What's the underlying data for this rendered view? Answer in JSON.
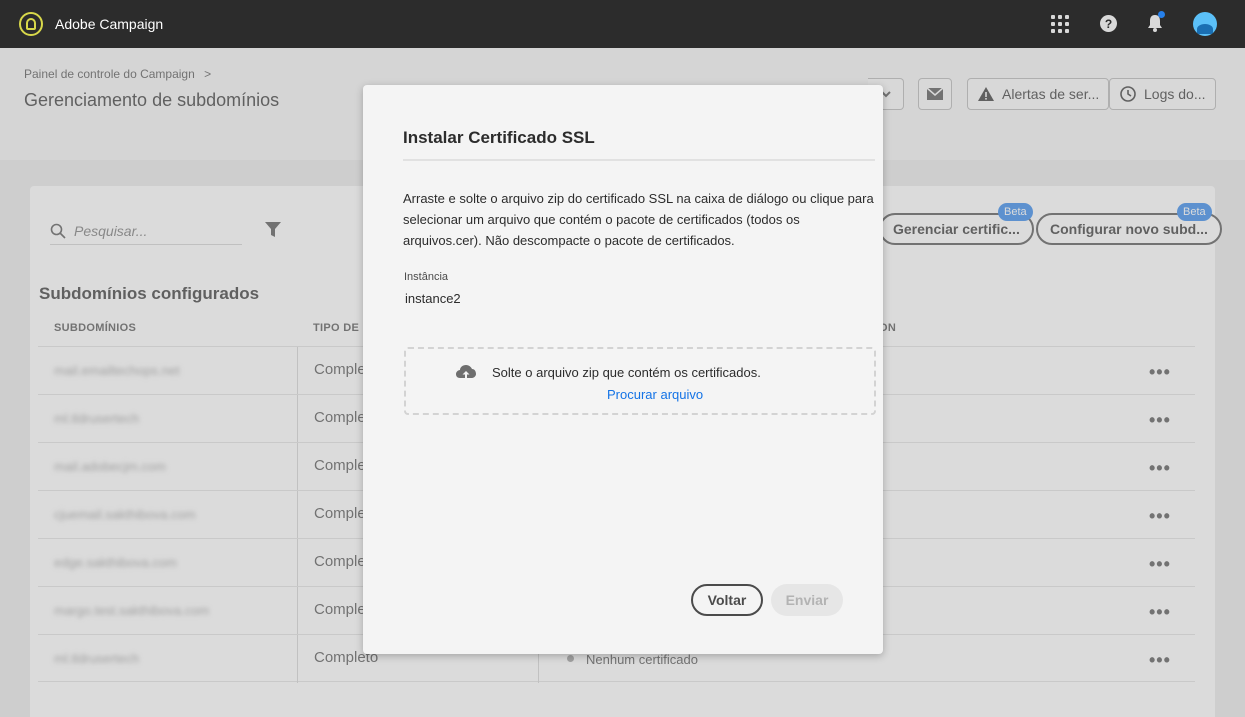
{
  "shell": {
    "app_name": "Adobe Campaign"
  },
  "header": {
    "breadcrumb": "Painel de controle do Campaign",
    "breadcrumb_sep": ">",
    "title": "Gerenciamento de subdomínios",
    "buttons": [
      {
        "label": "Alertas de ser...",
        "icon": "alert-icon"
      },
      {
        "label": "Logs do...",
        "icon": "history-icon"
      }
    ]
  },
  "toolbar": {
    "search_placeholder": "Pesquisar...",
    "manage_cert_label": "Gerenciar certific...",
    "configure_label": "Configurar novo subd...",
    "beta_label": "Beta"
  },
  "table": {
    "section_title": "Subdomínios configurados",
    "columns": [
      "SUBDOMÍNIOS",
      "TIPO DE D"
    ],
    "col3_partial": "ON",
    "rows": [
      {
        "subdomain": "mail.emailtechops.net",
        "type": "Comple"
      },
      {
        "subdomain": "ml.tldrusertech",
        "type": "Comple"
      },
      {
        "subdomain": "mail.adobecjm.com",
        "type": "Comple"
      },
      {
        "subdomain": "cjuemail.sakthibova.com",
        "type": "Comple"
      },
      {
        "subdomain": "edge.sakthibova.com",
        "type": "Comple"
      },
      {
        "subdomain": "margo.test.sakthibova.com",
        "type": "Comple"
      },
      {
        "subdomain": "ml.tldrusertech",
        "type": "Completo",
        "status": "Nenhum certificado"
      }
    ],
    "more_label": "•••"
  },
  "dialog": {
    "title": "Instalar Certificado SSL",
    "description": "Arraste e solte o arquivo zip do certificado SSL na caixa de diálogo ou clique para selecionar um arquivo que contém o pacote de certificados (todos os arquivos.cer). Não descompacte o pacote de certificados.",
    "instance_label": "Instância",
    "instance_value": "instance2",
    "drop_text": "Solte o arquivo zip que contém os certificados.",
    "browse_label": "Procurar arquivo",
    "back_label": "Voltar",
    "send_label": "Enviar"
  }
}
